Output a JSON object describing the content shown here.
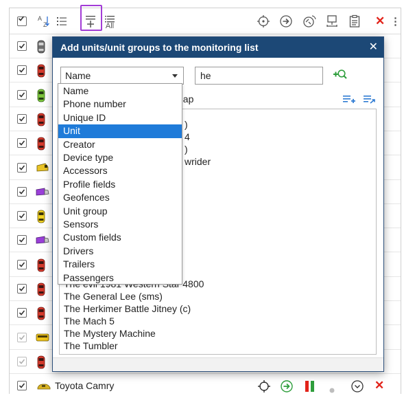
{
  "rows": [
    {
      "car": "gray",
      "checked": true,
      "faded": false
    },
    {
      "car": "red",
      "checked": true,
      "faded": false
    },
    {
      "car": "green",
      "checked": true,
      "faded": false
    },
    {
      "car": "red",
      "checked": true,
      "faded": false
    },
    {
      "car": "red",
      "checked": true,
      "faded": false
    },
    {
      "car": "truck-yellow",
      "checked": true,
      "faded": false
    },
    {
      "car": "truck-purple",
      "checked": true,
      "faded": false
    },
    {
      "car": "yellow",
      "checked": true,
      "faded": false
    },
    {
      "car": "truck-purple",
      "checked": true,
      "faded": false
    },
    {
      "car": "red",
      "checked": true,
      "faded": false
    },
    {
      "car": "red",
      "checked": true,
      "faded": false
    },
    {
      "car": "red",
      "checked": true,
      "faded": false
    },
    {
      "car": "bus-yellow",
      "checked": true,
      "faded": true
    },
    {
      "car": "red",
      "checked": true,
      "faded": true
    }
  ],
  "last_row": {
    "label": "Toyota Camry",
    "car": "sedan-yellow"
  },
  "dialog": {
    "title": "Add units/unit groups to the monitoring list",
    "close": "✕",
    "select_value": "Name",
    "search_value": "he",
    "sub_label": "hap",
    "partial_lines": [
      ")",
      "4",
      ")",
      "wrider"
    ],
    "results": [
      "The evil 1981 Western Star 4800",
      "The General Lee (sms)",
      "The Herkimer Battle Jitney (c)",
      "The Mach 5",
      "The Mystery Machine",
      "The Tumbler"
    ]
  },
  "dropdown": {
    "options": [
      "Name",
      "Phone number",
      "Unique ID",
      "Unit",
      "Creator",
      "Device type",
      "Accessors",
      "Profile fields",
      "Geofences",
      "Unit group",
      "Sensors",
      "Custom fields",
      "Drivers",
      "Trailers",
      "Passengers"
    ],
    "selected_index": 3
  },
  "colors": {
    "dialog_header": "#1c4876",
    "selected_option": "#1f7bd9",
    "highlight": "#a23cd6",
    "delete_red": "#e2231a",
    "green_action": "#2e9e3c"
  },
  "toolbar_icons": [
    "select-all-checkbox",
    "sort-az-icon",
    "list-icon",
    "add-selected-icon",
    "add-all-icon",
    "locate-icon",
    "navigate-icon",
    "watch-icon",
    "network-icon",
    "clipboard-icon",
    "delete-icon",
    "more-icon"
  ],
  "toolbar_labels": {
    "sort": "AZ",
    "all": "All"
  }
}
